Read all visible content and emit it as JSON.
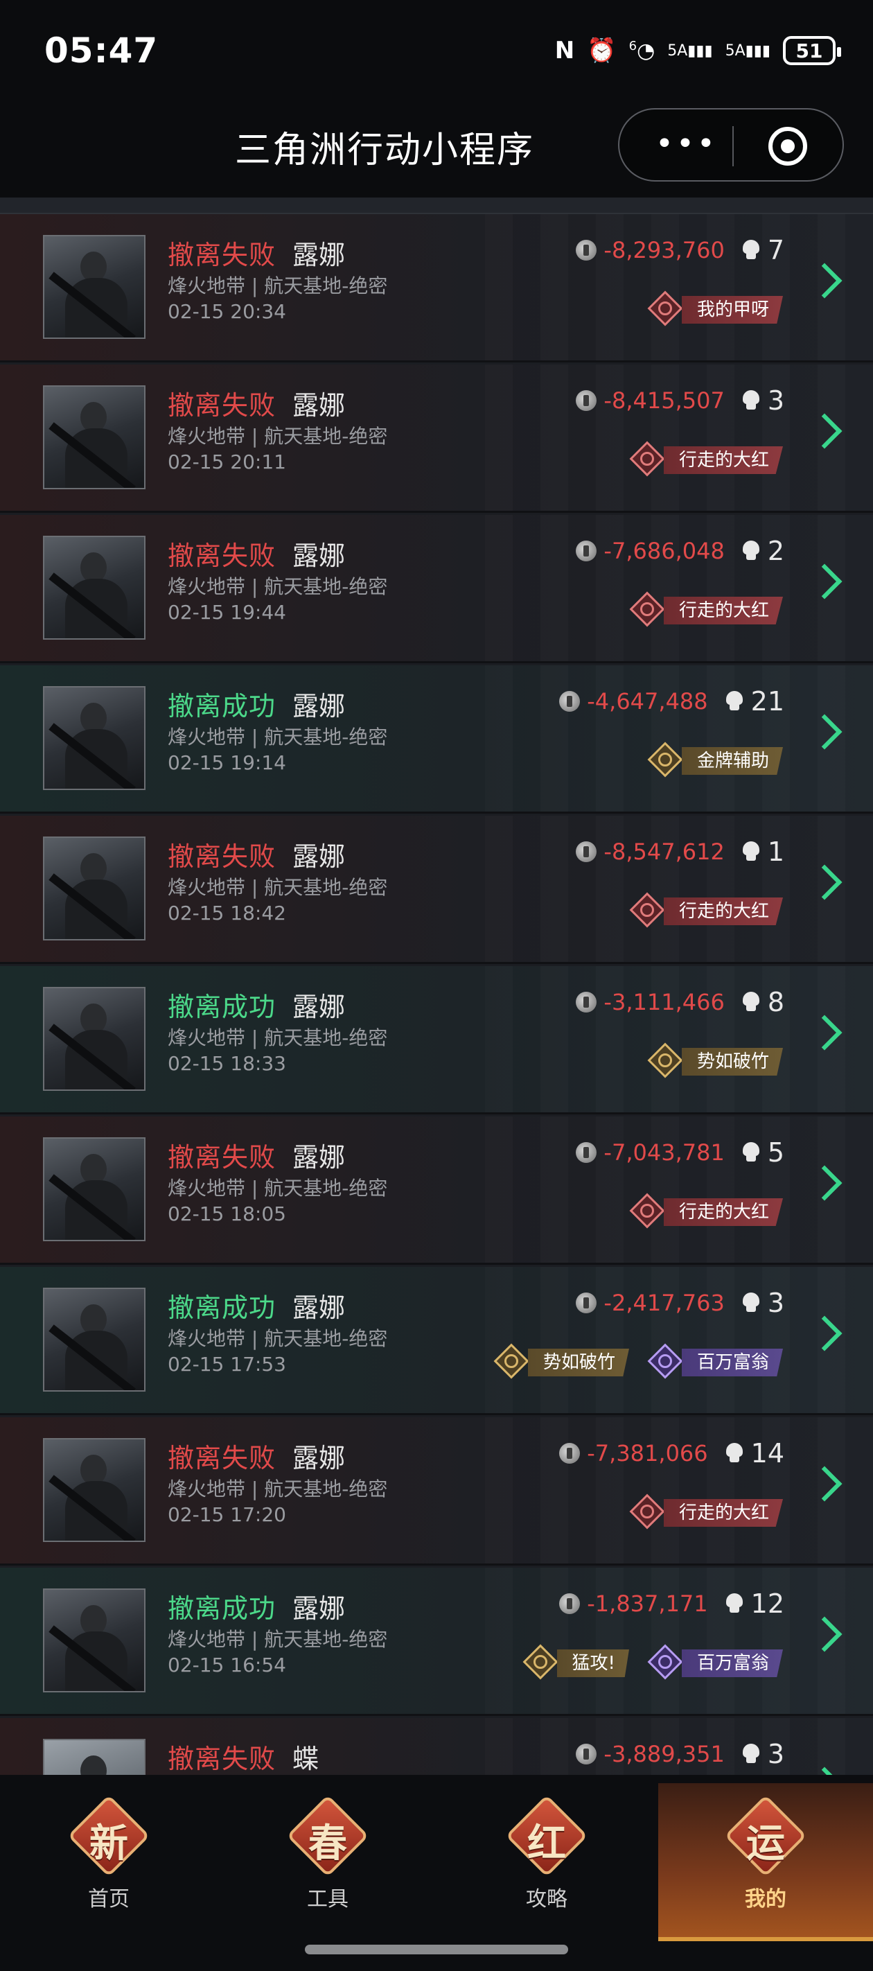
{
  "status_bar": {
    "time": "05:47",
    "nfc": "N",
    "alarm_icon": "alarm-icon",
    "wifi_label": "6",
    "net1": "5A",
    "net2": "5A",
    "battery": "51"
  },
  "header": {
    "title": "三角洲行动小程序",
    "more_label": "•••"
  },
  "records": [
    {
      "status": "撤离失败",
      "result": "fail",
      "name": "露娜",
      "map": "烽火地带 | 航天基地-绝密",
      "time": "02-15 20:34",
      "value": "-8,293,760",
      "kills": "7",
      "badges": [
        {
          "label": "我的甲呀",
          "color": "red"
        }
      ]
    },
    {
      "status": "撤离失败",
      "result": "fail",
      "name": "露娜",
      "map": "烽火地带 | 航天基地-绝密",
      "time": "02-15 20:11",
      "value": "-8,415,507",
      "kills": "3",
      "badges": [
        {
          "label": "行走的大红",
          "color": "red"
        }
      ]
    },
    {
      "status": "撤离失败",
      "result": "fail",
      "name": "露娜",
      "map": "烽火地带 | 航天基地-绝密",
      "time": "02-15 19:44",
      "value": "-7,686,048",
      "kills": "2",
      "badges": [
        {
          "label": "行走的大红",
          "color": "red"
        }
      ]
    },
    {
      "status": "撤离成功",
      "result": "ok",
      "name": "露娜",
      "map": "烽火地带 | 航天基地-绝密",
      "time": "02-15 19:14",
      "value": "-4,647,488",
      "kills": "21",
      "badges": [
        {
          "label": "金牌辅助",
          "color": "gold"
        }
      ]
    },
    {
      "status": "撤离失败",
      "result": "fail",
      "name": "露娜",
      "map": "烽火地带 | 航天基地-绝密",
      "time": "02-15 18:42",
      "value": "-8,547,612",
      "kills": "1",
      "badges": [
        {
          "label": "行走的大红",
          "color": "red"
        }
      ]
    },
    {
      "status": "撤离成功",
      "result": "ok",
      "name": "露娜",
      "map": "烽火地带 | 航天基地-绝密",
      "time": "02-15 18:33",
      "value": "-3,111,466",
      "kills": "8",
      "badges": [
        {
          "label": "势如破竹",
          "color": "gold"
        }
      ]
    },
    {
      "status": "撤离失败",
      "result": "fail",
      "name": "露娜",
      "map": "烽火地带 | 航天基地-绝密",
      "time": "02-15 18:05",
      "value": "-7,043,781",
      "kills": "5",
      "badges": [
        {
          "label": "行走的大红",
          "color": "red"
        }
      ]
    },
    {
      "status": "撤离成功",
      "result": "ok",
      "name": "露娜",
      "map": "烽火地带 | 航天基地-绝密",
      "time": "02-15 17:53",
      "value": "-2,417,763",
      "kills": "3",
      "badges": [
        {
          "label": "势如破竹",
          "color": "gold"
        },
        {
          "label": "百万富翁",
          "color": "purple"
        }
      ]
    },
    {
      "status": "撤离失败",
      "result": "fail",
      "name": "露娜",
      "map": "烽火地带 | 航天基地-绝密",
      "time": "02-15 17:20",
      "value": "-7,381,066",
      "kills": "14",
      "badges": [
        {
          "label": "行走的大红",
          "color": "red"
        }
      ]
    },
    {
      "status": "撤离成功",
      "result": "ok",
      "name": "露娜",
      "map": "烽火地带 | 航天基地-绝密",
      "time": "02-15 16:54",
      "value": "-1,837,171",
      "kills": "12",
      "badges": [
        {
          "label": "猛攻!",
          "color": "gold"
        },
        {
          "label": "百万富翁",
          "color": "purple"
        }
      ]
    },
    {
      "status": "撤离失败",
      "result": "fail",
      "name": "蝶",
      "map": "",
      "time": "",
      "value": "-3,889,351",
      "kills": "3",
      "badges": [],
      "avatar": "helmet"
    }
  ],
  "tabs": [
    {
      "char": "新",
      "label": "首页",
      "active": false
    },
    {
      "char": "春",
      "label": "工具",
      "active": false
    },
    {
      "char": "红",
      "label": "攻略",
      "active": false
    },
    {
      "char": "运",
      "label": "我的",
      "active": true
    }
  ],
  "colors": {
    "fail": "#e24a4a",
    "ok": "#4cd98a",
    "chevron": "#39d68c"
  }
}
